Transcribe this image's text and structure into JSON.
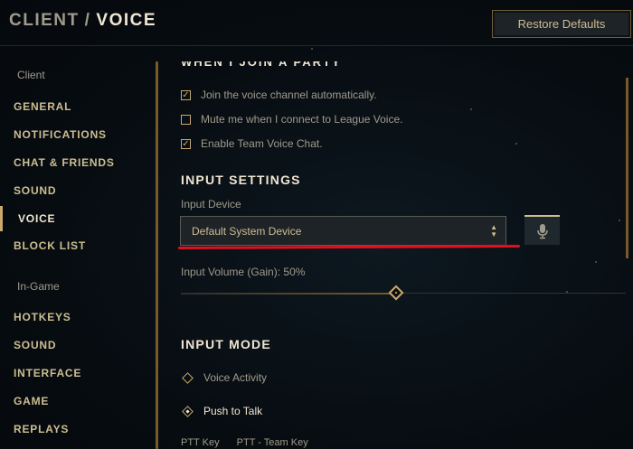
{
  "header": {
    "breadcrumb_parent": "CLIENT",
    "breadcrumb_sep": "/",
    "breadcrumb_current": "VOICE",
    "restore_label": "Restore Defaults"
  },
  "sidebar": {
    "client_label": "Client",
    "client_items": [
      "GENERAL",
      "NOTIFICATIONS",
      "CHAT & FRIENDS",
      "SOUND",
      "VOICE",
      "BLOCK LIST"
    ],
    "ingame_label": "In-Game",
    "ingame_items": [
      "HOTKEYS",
      "SOUND",
      "INTERFACE",
      "GAME",
      "REPLAYS"
    ],
    "active_item": "VOICE"
  },
  "party_section": {
    "heading": "WHEN I JOIN A PARTY",
    "options": [
      {
        "label": "Join the voice channel automatically.",
        "checked": true
      },
      {
        "label": "Mute me when I connect to League Voice.",
        "checked": false
      },
      {
        "label": "Enable Team Voice Chat.",
        "checked": true
      }
    ]
  },
  "input_settings": {
    "heading": "INPUT SETTINGS",
    "device_label": "Input Device",
    "device_value": "Default System Device",
    "volume_label": "Input Volume (Gain): 50%",
    "volume_fraction": 0.5
  },
  "input_mode": {
    "heading": "INPUT MODE",
    "options": [
      {
        "label": "Voice Activity",
        "selected": false
      },
      {
        "label": "Push to Talk",
        "selected": true
      }
    ],
    "ptt_key_label": "PTT Key",
    "ptt_team_label": "PTT - Team Key"
  },
  "icons": {
    "mic": "microphone-icon",
    "check": "checkmark-icon",
    "arrows": "up-down-chevron-icon"
  },
  "colors": {
    "gold": "#c8aa6e",
    "text_light": "#f0e6d2",
    "text_dim": "#a09b8c",
    "annotation_red": "#e0101e"
  }
}
